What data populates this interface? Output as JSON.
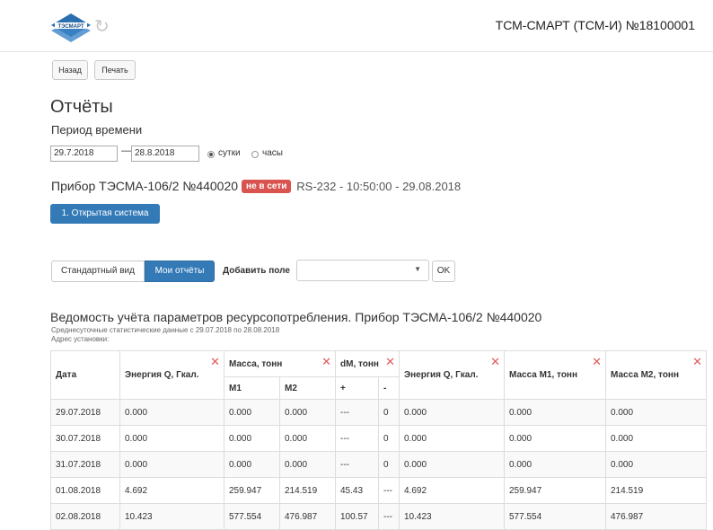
{
  "header": {
    "logo_text": "ТЭСМАРТ",
    "device_title": "ТСМ-СМАРТ (ТСМ-И) №18100001",
    "icons": {
      "logo": "tesmart-logo",
      "refresh": "refresh-icon"
    }
  },
  "toolbar": {
    "back_label": "Назад",
    "print_label": "Печать"
  },
  "page_title": "Отчёты",
  "period": {
    "label": "Период времени",
    "from": "29.7.2018",
    "dash": "—",
    "to": "28.8.2018",
    "radio_day": "сутки",
    "radio_hour": "часы",
    "selected": "сутки"
  },
  "device": {
    "name": "Прибор ТЭСМА-106/2 №440020",
    "status_badge": "не в сети",
    "status_color": "#d9534f",
    "connection": "RS-232 - 10:50:00 - 29.08.2018"
  },
  "system_button": "1. Открытая система",
  "view": {
    "standard": "Стандартный вид",
    "mine": "Мои отчёты",
    "add_field": "Добавить поле",
    "select_value": "",
    "ok": "OK"
  },
  "report": {
    "title": "Ведомость учёта параметров ресурсопотребления. Прибор ТЭСМА-106/2 №440020",
    "subtitle": "Среднесуточные статистические данные с 29.07.2018 по 28.08.2018",
    "address": "Адрес установки:"
  },
  "table": {
    "headers": [
      "Дата",
      "Энергия Q, Гкал.",
      "Масса, тонн",
      "dM, тонн",
      "Энергия Q, Гкал.",
      "Масса М1, тонн",
      "Масса М2, тонн"
    ],
    "subheaders": [
      "M1",
      "M2",
      "+",
      "-"
    ],
    "rows": [
      [
        "29.07.2018",
        "0.000",
        "0.000",
        "0.000",
        "---",
        "0",
        "0.000",
        "0.000",
        "0.000"
      ],
      [
        "30.07.2018",
        "0.000",
        "0.000",
        "0.000",
        "---",
        "0",
        "0.000",
        "0.000",
        "0.000"
      ],
      [
        "31.07.2018",
        "0.000",
        "0.000",
        "0.000",
        "---",
        "0",
        "0.000",
        "0.000",
        "0.000"
      ],
      [
        "01.08.2018",
        "4.692",
        "259.947",
        "214.519",
        "45.43",
        "---",
        "4.692",
        "259.947",
        "214.519"
      ],
      [
        "02.08.2018",
        "10.423",
        "577.554",
        "476.987",
        "100.57",
        "---",
        "10.423",
        "577.554",
        "476.987"
      ]
    ]
  }
}
